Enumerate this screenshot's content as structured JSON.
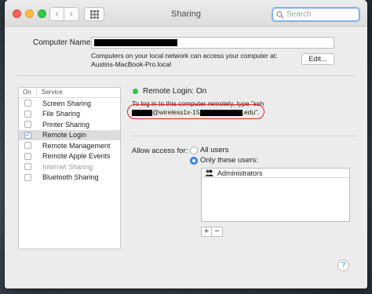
{
  "window": {
    "title": "Sharing"
  },
  "search": {
    "placeholder": "Search"
  },
  "computer_name": {
    "label": "Computer Name:",
    "description_line1": "Computers on your local network can access your computer at:",
    "description_line2": "Austins-MacBook-Pro.local",
    "edit_label": "Edit..."
  },
  "services": {
    "header_on": "On",
    "header_service": "Service",
    "items": [
      {
        "label": "Screen Sharing",
        "checked": false,
        "selected": false,
        "disabled": false
      },
      {
        "label": "File Sharing",
        "checked": false,
        "selected": false,
        "disabled": false
      },
      {
        "label": "Printer Sharing",
        "checked": false,
        "selected": false,
        "disabled": false
      },
      {
        "label": "Remote Login",
        "checked": true,
        "selected": true,
        "disabled": false
      },
      {
        "label": "Remote Management",
        "checked": false,
        "selected": false,
        "disabled": false
      },
      {
        "label": "Remote Apple Events",
        "checked": false,
        "selected": false,
        "disabled": false
      },
      {
        "label": "Internet Sharing",
        "checked": false,
        "selected": false,
        "disabled": true
      },
      {
        "label": "Bluetooth Sharing",
        "checked": false,
        "selected": false,
        "disabled": false
      }
    ]
  },
  "remote_login": {
    "status": "Remote Login: On",
    "status_color": "#36c24a",
    "info_line1": "To log in to this computer remotely, type \"ssh",
    "info_host_a": "@wireless1x-15",
    "info_host_b": ".edu\".",
    "highlight_color": "#e0251f"
  },
  "access": {
    "label": "Allow access for:",
    "option_all": "All users",
    "option_only": "Only these users:",
    "selected": "only",
    "users": [
      "Administrators"
    ],
    "add_label": "+",
    "remove_label": "−"
  },
  "help": {
    "label": "?"
  },
  "icons": {
    "search": "search-icon",
    "back": "chevron-left-icon",
    "forward": "chevron-right-icon",
    "grid": "grid-icon",
    "group": "user-group-icon",
    "help": "help-icon"
  }
}
